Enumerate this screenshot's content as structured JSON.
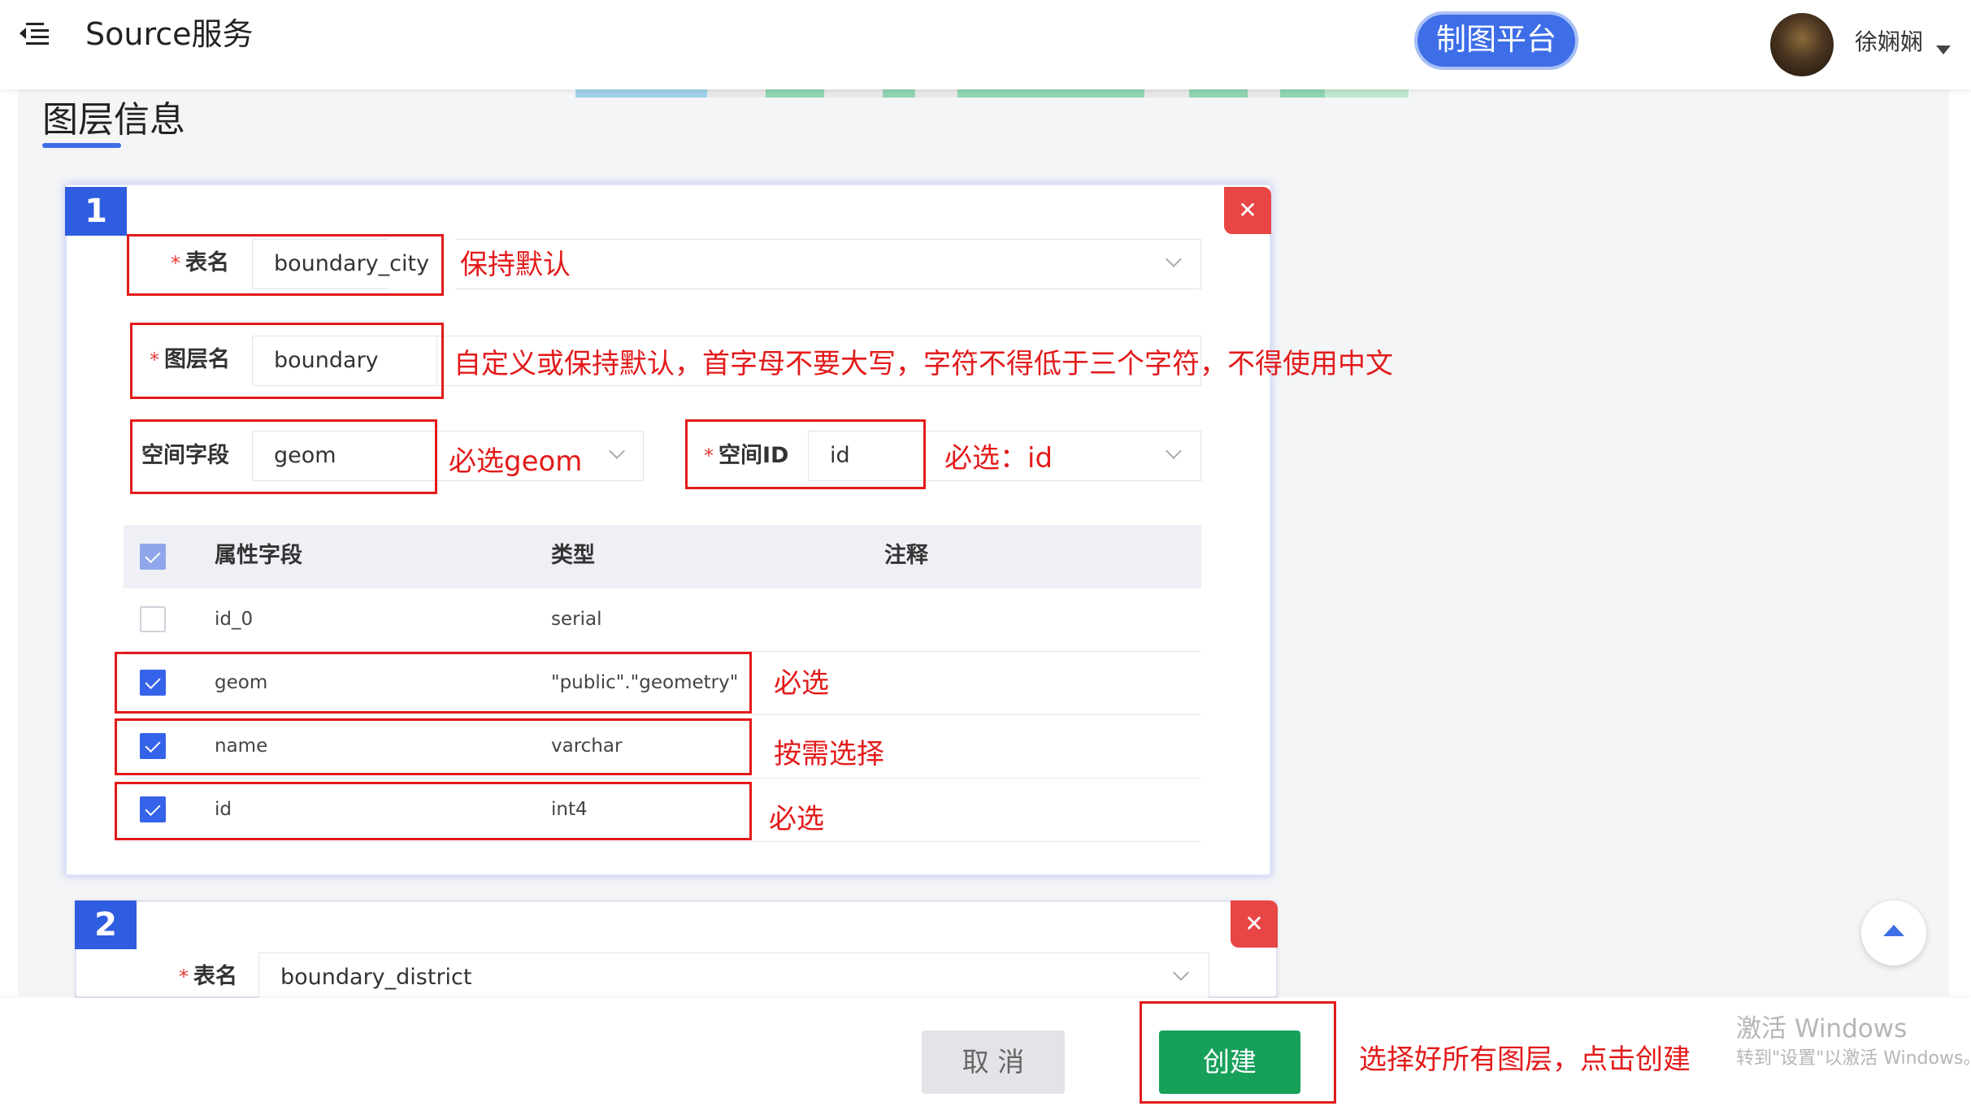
{
  "header": {
    "app_title": "Source服务",
    "platform_button": "制图平台",
    "user_name": "徐娴娴"
  },
  "section_title": "图层信息",
  "layer1": {
    "index": "1",
    "table_name_label": "表名",
    "table_name_value": "boundary_city",
    "layer_name_label": "图层名",
    "layer_name_value": "boundary",
    "geom_field_label": "空间字段",
    "geom_field_value": "geom",
    "space_id_label": "空间ID",
    "space_id_value": "id",
    "columns": {
      "field": "属性字段",
      "type": "类型",
      "comment": "注释"
    },
    "rows": [
      {
        "field": "id_0",
        "type": "serial",
        "checked": false
      },
      {
        "field": "geom",
        "type": "\"public\".\"geometry\"",
        "checked": true
      },
      {
        "field": "name",
        "type": "varchar",
        "checked": true
      },
      {
        "field": "id",
        "type": "int4",
        "checked": true
      }
    ]
  },
  "layer2": {
    "index": "2",
    "table_name_label": "表名",
    "table_name_value": "boundary_district"
  },
  "annotations": {
    "keep_default": "保持默认",
    "layer_name_hint": "自定义或保持默认，首字母不要大写，字符不得低于三个字符，不得使用中文",
    "geom_hint": "必选geom",
    "id_hint": "必选：id",
    "required_geom": "必选",
    "optional_name": "按需选择",
    "required_id": "必选",
    "create_hint": "选择好所有图层，点击创建"
  },
  "footer": {
    "cancel_label": "取 消",
    "create_label": "创建"
  },
  "watermark": {
    "line1": "激活 Windows",
    "line2": "转到\"设置\"以激活 Windows。"
  },
  "colors": {
    "accent": "#3d6ee8",
    "annotation_red": "#e31a1a",
    "create_green": "#16a05a",
    "close_red": "#e84545"
  }
}
